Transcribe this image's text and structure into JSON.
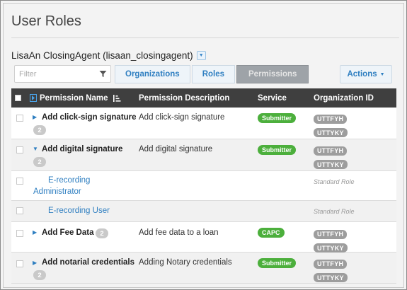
{
  "page": {
    "title": "User Roles"
  },
  "user": {
    "name": "LisaAn ClosingAgent (lisaan_closingagent)",
    "dropdown_icon": "chevron-down-icon"
  },
  "toolbar": {
    "filter_placeholder": "Filter",
    "filter_icon": "funnel-icon",
    "tabs": [
      {
        "label": "Organizations",
        "active": false
      },
      {
        "label": "Roles",
        "active": false
      },
      {
        "label": "Permissions",
        "active": true
      }
    ],
    "actions_label": "Actions"
  },
  "table": {
    "headers": {
      "permission_name": "Permission Name",
      "permission_description": "Permission Description",
      "service": "Service",
      "organization_id": "Organization ID"
    },
    "rows": [
      {
        "name": "Add click-sign signature",
        "expand": "right",
        "count": "2",
        "description": "Add click-sign signature",
        "service": "Submitter",
        "orgs": [
          "UTTFYH",
          "UTTYKY"
        ]
      },
      {
        "name": "Add digital signature",
        "expand": "down",
        "count": "2",
        "description": "Add digital signature",
        "service": "Submitter",
        "orgs": [
          "UTTFYH",
          "UTTYKY"
        ]
      },
      {
        "name_line1": "E-recording",
        "name_line2": "Administrator",
        "role_note": "Standard Role"
      },
      {
        "name_line1": "E-recording User",
        "role_note": "Standard Role"
      },
      {
        "name": "Add Fee Data",
        "expand": "right",
        "count": "2",
        "description": "Add fee data to a loan",
        "service": "CAPC",
        "orgs": [
          "UTTFYH",
          "UTTYKY"
        ]
      },
      {
        "name": "Add notarial credentials",
        "expand": "right",
        "count": "2",
        "description": "Adding Notary credentials",
        "service": "Submitter",
        "orgs": [
          "UTTFYH",
          "UTTYKY"
        ]
      }
    ]
  },
  "colors": {
    "accent": "#2f7fc1",
    "header_bg": "#3f3f3f",
    "service_badge": "#4caf3c",
    "org_tag": "#9d9d9d",
    "active_tab": "#9ea3a8"
  }
}
